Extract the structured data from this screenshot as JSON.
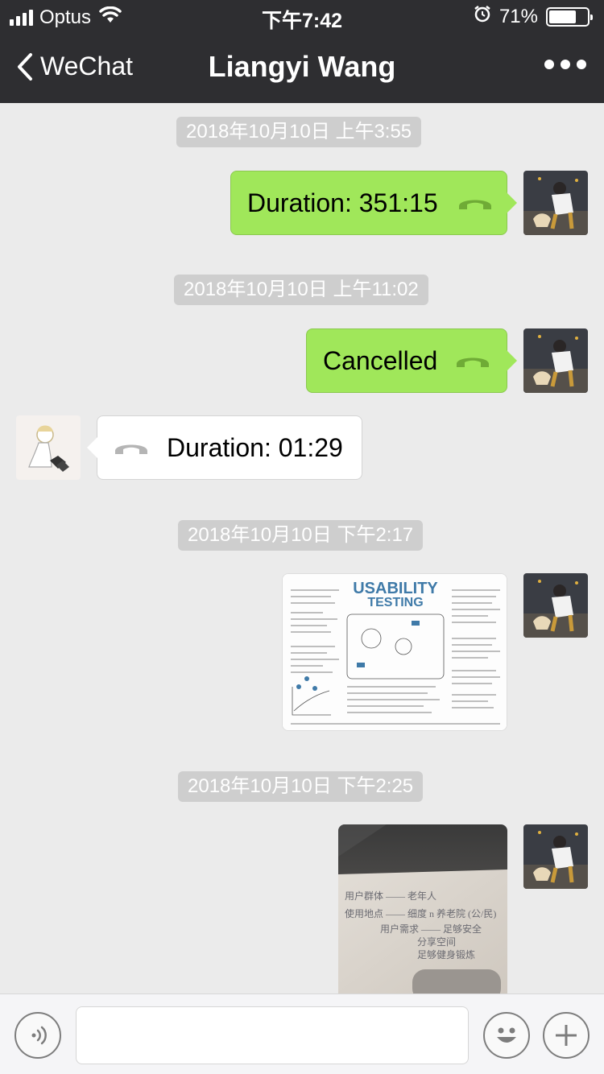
{
  "status_bar": {
    "carrier": "Optus",
    "time": "下午7:42",
    "battery_percent": "71%",
    "battery_level": 0.71,
    "icons": [
      "signal-icon",
      "wifi-icon",
      "alarm-icon",
      "battery-icon"
    ]
  },
  "nav": {
    "back_label": "WeChat",
    "title": "Liangyi Wang",
    "more_icon": "more-dots-icon"
  },
  "messages": {
    "ts1": "2018年10月10日 上午3:55",
    "call1": "Duration: 351:15",
    "ts2": "2018年10月10日 上午11:02",
    "call2": "Cancelled",
    "call3": "Duration: 01:29",
    "ts3": "2018年10月10日 下午2:17",
    "ts4": "2018年10月10日 下午2:25",
    "sketch_title": "USABILITY",
    "sketch_subtitle": "TESTING",
    "note_lines": [
      "用户群体 —— 老年人",
      "使用地点 —— 细度 n 养老院 (公/民)",
      "用户需求 —— 足够安全",
      "分享空间",
      "足够健身锻炼"
    ]
  },
  "input_bar": {
    "placeholder": "",
    "icons": [
      "voice-icon",
      "emoji-icon",
      "plus-icon"
    ]
  },
  "colors": {
    "header_bg": "#2e2e31",
    "chat_bg": "#ebebeb",
    "outgoing_bubble": "#a0e75a",
    "incoming_bubble": "#ffffff",
    "timestamp_bg": "#cecece"
  }
}
